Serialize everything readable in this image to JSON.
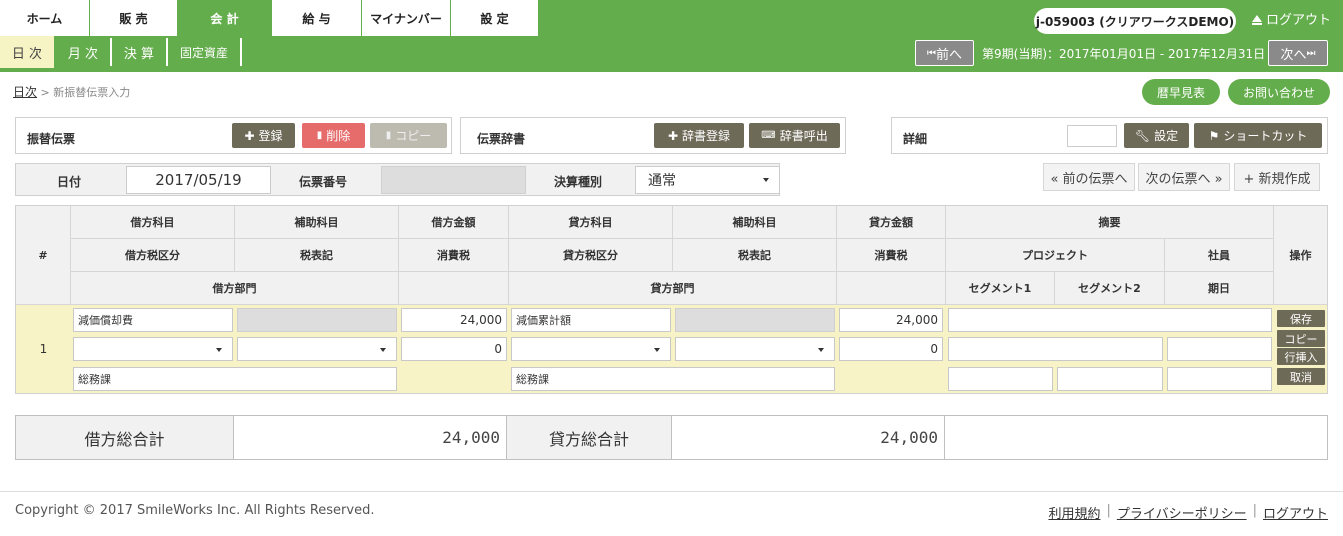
{
  "nav": {
    "tabs": [
      {
        "label": "ホーム"
      },
      {
        "label": "販 売"
      },
      {
        "label": "会 計"
      },
      {
        "label": "給 与"
      },
      {
        "label": "マイナンバー"
      },
      {
        "label": "設 定"
      }
    ],
    "user": "j-059003 (クリアワークスDEMO)",
    "logout": "ログアウト"
  },
  "subnav": {
    "tabs": [
      {
        "label": "日 次"
      },
      {
        "label": "月 次"
      },
      {
        "label": "決 算"
      },
      {
        "label": "固定資産"
      }
    ],
    "prev": "前へ",
    "next": "次へ",
    "period": "第9期(当期)：2017年01月01日 - 2017年12月31日"
  },
  "breadcrumb": {
    "link": "日次",
    "sep": ">",
    "current": "新振替伝票入力"
  },
  "top_buttons": {
    "calendar": "暦早見表",
    "contact": "お問い合わせ"
  },
  "voucher_panel": {
    "title": "振替伝票",
    "register": "登録",
    "delete": "削除",
    "copy": "コピー"
  },
  "dict_panel": {
    "title": "伝票辞書",
    "register": "辞書登録",
    "call": "辞書呼出"
  },
  "detail_panel": {
    "title": "詳細",
    "settings": "設定",
    "shortcut": "ショートカット"
  },
  "form": {
    "date_label": "日付",
    "date_value": "2017/05/19",
    "number_label": "伝票番号",
    "number_value": "",
    "type_label": "決算種別",
    "type_value": "通常"
  },
  "nav_buttons": {
    "prev": "« 前の伝票へ",
    "next": "次の伝票へ »",
    "new": "+ 新規作成"
  },
  "grid": {
    "headers": {
      "num": "#",
      "debit_account": "借方科目",
      "debit_sub": "補助科目",
      "debit_amount": "借方金額",
      "credit_account": "貸方科目",
      "credit_sub": "補助科目",
      "credit_amount": "貸方金額",
      "memo": "摘要",
      "debit_tax_class": "借方税区分",
      "debit_tax_mark": "税表記",
      "debit_tax": "消費税",
      "credit_tax_class": "貸方税区分",
      "credit_tax_mark": "税表記",
      "credit_tax": "消費税",
      "project": "プロジェクト",
      "staff": "社員",
      "ops": "操作",
      "debit_dept": "借方部門",
      "credit_dept": "貸方部門",
      "segment1": "セグメント1",
      "segment2": "セグメント2",
      "due": "期日"
    },
    "rows": [
      {
        "num": "1",
        "debit_account": "減価償却費",
        "debit_amount": "24,000",
        "credit_account": "減価累計額",
        "credit_amount": "24,000",
        "debit_tax": "0",
        "credit_tax": "0",
        "debit_dept": "総務課",
        "credit_dept": "総務課",
        "ops": {
          "save": "保存",
          "copy": "コピー",
          "insert": "行挿入",
          "cancel": "取消"
        }
      }
    ]
  },
  "totals": {
    "debit_label": "借方総合計",
    "debit_value": "24,000",
    "credit_label": "貸方総合計",
    "credit_value": "24,000"
  },
  "footer": {
    "copyright": "Copyright © 2017 SmileWorks Inc. All Rights Reserved.",
    "terms": "利用規約",
    "privacy": "プライバシーポリシー",
    "logout": "ログアウト",
    "sep": "|"
  }
}
